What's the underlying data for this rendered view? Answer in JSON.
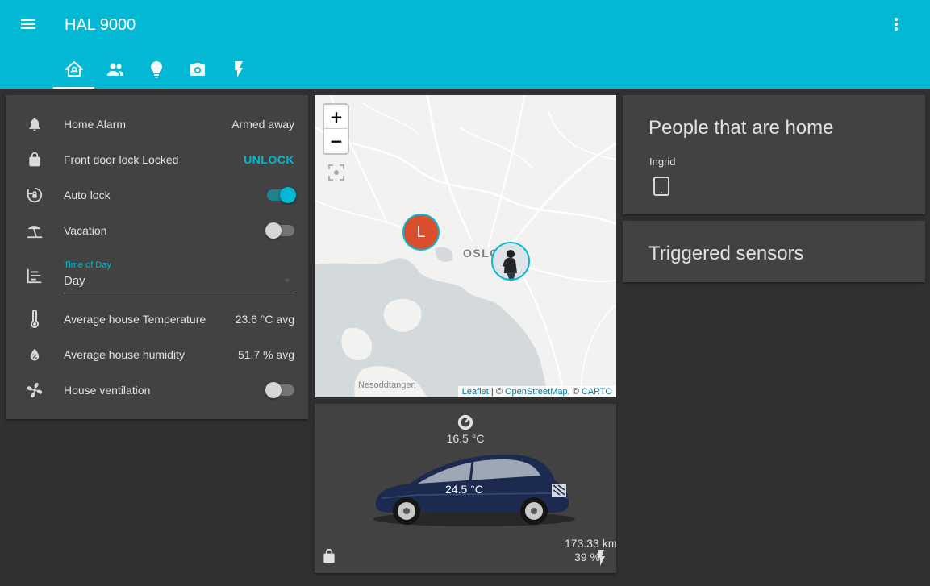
{
  "header": {
    "title": "HAL 9000",
    "tabs": [
      {
        "icon": "home-automation-icon",
        "active": true
      },
      {
        "icon": "account-group-icon",
        "active": false
      },
      {
        "icon": "lightbulb-icon",
        "active": false
      },
      {
        "icon": "camera-icon",
        "active": false
      },
      {
        "icon": "flash-icon",
        "active": false
      }
    ]
  },
  "entities": {
    "alarm": {
      "label": "Home Alarm",
      "value": "Armed away"
    },
    "door": {
      "label": "Front door lock Locked",
      "action": "UNLOCK"
    },
    "autolock": {
      "label": "Auto lock",
      "state": "on"
    },
    "vacation": {
      "label": "Vacation",
      "state": "off"
    },
    "time_of_day": {
      "label": "Time of Day",
      "value": "Day"
    },
    "temperature": {
      "label": "Average house Temperature",
      "value": "23.6 °C avg"
    },
    "humidity": {
      "label": "Average house humidity",
      "value": "51.7 % avg"
    },
    "ventilation": {
      "label": "House ventilation",
      "state": "off"
    }
  },
  "map": {
    "zoom_in": "+",
    "zoom_out": "−",
    "city": "OSLO",
    "place": "Nesoddtangen",
    "marker_letter": "L",
    "attribution": {
      "leaflet": "Leaflet",
      "sep1": " | © ",
      "osm": "OpenStreetMap",
      "sep2": ", © ",
      "carto": "CARTO"
    }
  },
  "car": {
    "outside_temp": "16.5 °C",
    "inside_temp": "24.5 °C",
    "range": "173.33 km",
    "battery": "39 %"
  },
  "people": {
    "title": "People that are home",
    "person": "Ingrid"
  },
  "sensors": {
    "title": "Triggered sensors"
  },
  "colors": {
    "primary": "#03b8d4",
    "background": "#303030",
    "card": "#424242",
    "marker": "#db4e2d"
  }
}
